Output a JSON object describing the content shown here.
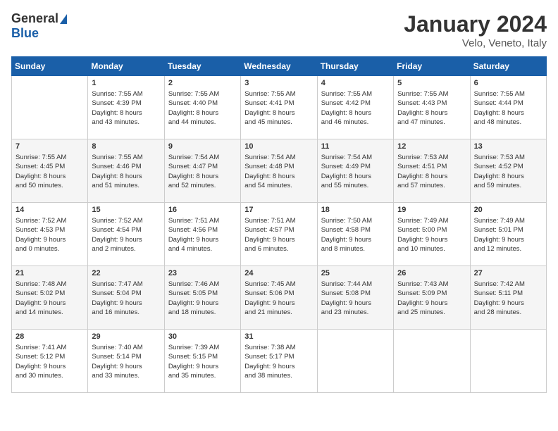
{
  "header": {
    "logo_general": "General",
    "logo_blue": "Blue",
    "month_title": "January 2024",
    "location": "Velo, Veneto, Italy"
  },
  "days_of_week": [
    "Sunday",
    "Monday",
    "Tuesday",
    "Wednesday",
    "Thursday",
    "Friday",
    "Saturday"
  ],
  "weeks": [
    [
      {
        "day": "",
        "data": ""
      },
      {
        "day": "1",
        "data": "Sunrise: 7:55 AM\nSunset: 4:39 PM\nDaylight: 8 hours\nand 43 minutes."
      },
      {
        "day": "2",
        "data": "Sunrise: 7:55 AM\nSunset: 4:40 PM\nDaylight: 8 hours\nand 44 minutes."
      },
      {
        "day": "3",
        "data": "Sunrise: 7:55 AM\nSunset: 4:41 PM\nDaylight: 8 hours\nand 45 minutes."
      },
      {
        "day": "4",
        "data": "Sunrise: 7:55 AM\nSunset: 4:42 PM\nDaylight: 8 hours\nand 46 minutes."
      },
      {
        "day": "5",
        "data": "Sunrise: 7:55 AM\nSunset: 4:43 PM\nDaylight: 8 hours\nand 47 minutes."
      },
      {
        "day": "6",
        "data": "Sunrise: 7:55 AM\nSunset: 4:44 PM\nDaylight: 8 hours\nand 48 minutes."
      }
    ],
    [
      {
        "day": "7",
        "data": "Sunrise: 7:55 AM\nSunset: 4:45 PM\nDaylight: 8 hours\nand 50 minutes."
      },
      {
        "day": "8",
        "data": "Sunrise: 7:55 AM\nSunset: 4:46 PM\nDaylight: 8 hours\nand 51 minutes."
      },
      {
        "day": "9",
        "data": "Sunrise: 7:54 AM\nSunset: 4:47 PM\nDaylight: 8 hours\nand 52 minutes."
      },
      {
        "day": "10",
        "data": "Sunrise: 7:54 AM\nSunset: 4:48 PM\nDaylight: 8 hours\nand 54 minutes."
      },
      {
        "day": "11",
        "data": "Sunrise: 7:54 AM\nSunset: 4:49 PM\nDaylight: 8 hours\nand 55 minutes."
      },
      {
        "day": "12",
        "data": "Sunrise: 7:53 AM\nSunset: 4:51 PM\nDaylight: 8 hours\nand 57 minutes."
      },
      {
        "day": "13",
        "data": "Sunrise: 7:53 AM\nSunset: 4:52 PM\nDaylight: 8 hours\nand 59 minutes."
      }
    ],
    [
      {
        "day": "14",
        "data": "Sunrise: 7:52 AM\nSunset: 4:53 PM\nDaylight: 9 hours\nand 0 minutes."
      },
      {
        "day": "15",
        "data": "Sunrise: 7:52 AM\nSunset: 4:54 PM\nDaylight: 9 hours\nand 2 minutes."
      },
      {
        "day": "16",
        "data": "Sunrise: 7:51 AM\nSunset: 4:56 PM\nDaylight: 9 hours\nand 4 minutes."
      },
      {
        "day": "17",
        "data": "Sunrise: 7:51 AM\nSunset: 4:57 PM\nDaylight: 9 hours\nand 6 minutes."
      },
      {
        "day": "18",
        "data": "Sunrise: 7:50 AM\nSunset: 4:58 PM\nDaylight: 9 hours\nand 8 minutes."
      },
      {
        "day": "19",
        "data": "Sunrise: 7:49 AM\nSunset: 5:00 PM\nDaylight: 9 hours\nand 10 minutes."
      },
      {
        "day": "20",
        "data": "Sunrise: 7:49 AM\nSunset: 5:01 PM\nDaylight: 9 hours\nand 12 minutes."
      }
    ],
    [
      {
        "day": "21",
        "data": "Sunrise: 7:48 AM\nSunset: 5:02 PM\nDaylight: 9 hours\nand 14 minutes."
      },
      {
        "day": "22",
        "data": "Sunrise: 7:47 AM\nSunset: 5:04 PM\nDaylight: 9 hours\nand 16 minutes."
      },
      {
        "day": "23",
        "data": "Sunrise: 7:46 AM\nSunset: 5:05 PM\nDaylight: 9 hours\nand 18 minutes."
      },
      {
        "day": "24",
        "data": "Sunrise: 7:45 AM\nSunset: 5:06 PM\nDaylight: 9 hours\nand 21 minutes."
      },
      {
        "day": "25",
        "data": "Sunrise: 7:44 AM\nSunset: 5:08 PM\nDaylight: 9 hours\nand 23 minutes."
      },
      {
        "day": "26",
        "data": "Sunrise: 7:43 AM\nSunset: 5:09 PM\nDaylight: 9 hours\nand 25 minutes."
      },
      {
        "day": "27",
        "data": "Sunrise: 7:42 AM\nSunset: 5:11 PM\nDaylight: 9 hours\nand 28 minutes."
      }
    ],
    [
      {
        "day": "28",
        "data": "Sunrise: 7:41 AM\nSunset: 5:12 PM\nDaylight: 9 hours\nand 30 minutes."
      },
      {
        "day": "29",
        "data": "Sunrise: 7:40 AM\nSunset: 5:14 PM\nDaylight: 9 hours\nand 33 minutes."
      },
      {
        "day": "30",
        "data": "Sunrise: 7:39 AM\nSunset: 5:15 PM\nDaylight: 9 hours\nand 35 minutes."
      },
      {
        "day": "31",
        "data": "Sunrise: 7:38 AM\nSunset: 5:17 PM\nDaylight: 9 hours\nand 38 minutes."
      },
      {
        "day": "",
        "data": ""
      },
      {
        "day": "",
        "data": ""
      },
      {
        "day": "",
        "data": ""
      }
    ]
  ]
}
